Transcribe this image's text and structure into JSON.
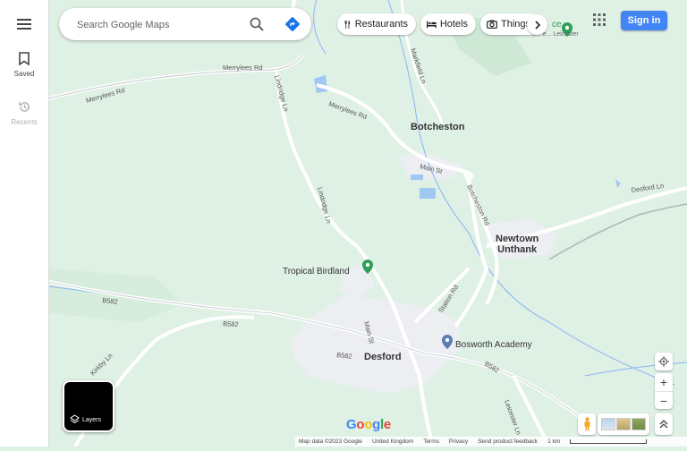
{
  "sidebar": {
    "menu_icon": "menu-icon",
    "items": [
      {
        "label": "Saved",
        "icon": "bookmark-icon"
      },
      {
        "label": "Recents",
        "icon": "history-icon"
      }
    ]
  },
  "search": {
    "placeholder": "Search Google Maps",
    "icons": [
      "search-icon",
      "directions-icon"
    ]
  },
  "chips": [
    {
      "label": "Restaurants",
      "icon": "fork-knife-icon"
    },
    {
      "label": "Hotels",
      "icon": "bed-icon"
    },
    {
      "label": "Things",
      "icon": "camera-icon"
    }
  ],
  "header": {
    "signin_label": "Sign in",
    "apps_icon": "apps-grid-icon"
  },
  "map": {
    "places": [
      {
        "name": "Botcheston",
        "type": "town"
      },
      {
        "name": "Newtown\nUnthank",
        "type": "town"
      },
      {
        "name": "Desford",
        "type": "town"
      },
      {
        "name": "Tropical Birdland",
        "type": "poi"
      },
      {
        "name": "Bosworth Academy",
        "type": "poi"
      }
    ],
    "partial_label": "ce",
    "partial_label_2": "Pe...  Leicester",
    "roads": [
      "Merrylees Rd",
      "Merrylees Rd",
      "Merrylees Rd",
      "Lindridge Ln",
      "Lindridge Ln",
      "Main St",
      "Main St",
      "Botcheston Rd",
      "Desford Ln",
      "B582",
      "B582",
      "B582",
      "B582",
      "Station Rd",
      "Kirkby Ln",
      "Leicester Ln",
      "Markfield Ln"
    ]
  },
  "controls": {
    "layers_label": "Layers",
    "zoom_in": "+",
    "zoom_out": "−"
  },
  "footer": {
    "items": [
      "Map data ©2023 Google",
      "United Kingdom",
      "Terms",
      "Privacy",
      "Send product feedback"
    ],
    "scale": "1 km"
  },
  "logo": "Google",
  "colors": {
    "map_bg": "#dff0e4",
    "accent": "#4285f4",
    "town_area": "#eceef1"
  }
}
